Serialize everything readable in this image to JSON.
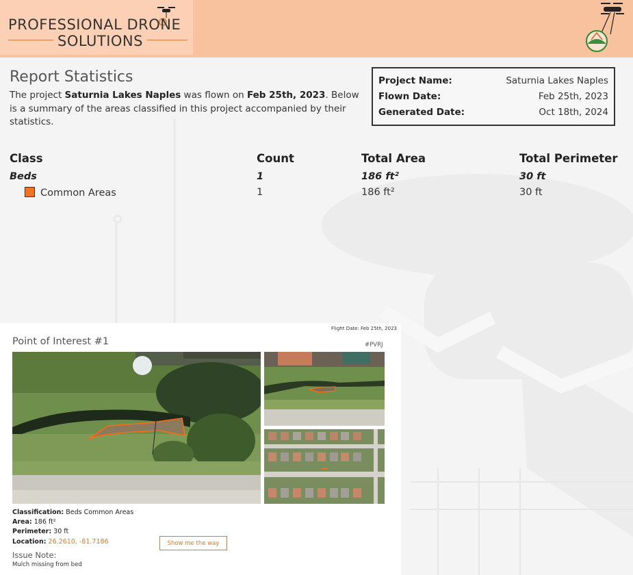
{
  "header": {
    "logo_line1": "PROFESSIONAL DRONE",
    "logo_line2": "SOLUTIONS"
  },
  "report": {
    "title": "Report Statistics",
    "intro_pre": "The project ",
    "project_name": "Saturnia Lakes Naples",
    "intro_mid": " was flown on ",
    "flown_date": "Feb 25th, 2023",
    "intro_post": ". Below is a summary of the areas classified in this project accompanied by their statistics."
  },
  "info": {
    "project_label": "Project Name:",
    "project_value": "Saturnia Lakes Naples",
    "flown_label": "Flown Date:",
    "flown_value": "Feb 25th, 2023",
    "generated_label": "Generated Date:",
    "generated_value": "Oct 18th, 2024"
  },
  "stats": {
    "headers": [
      "Class",
      "Count",
      "Total Area",
      "Total Perimeter"
    ],
    "group": {
      "name": "Beds",
      "count": "1",
      "area": "186 ft²",
      "perimeter": "30 ft"
    },
    "items": [
      {
        "name": "Common Areas",
        "count": "1",
        "area": "186 ft²",
        "perimeter": "30 ft",
        "color": "#f07422"
      }
    ]
  },
  "poi": {
    "flight_date": "Flight Date: Feb 25th, 2023",
    "title": "Point of Interest #1",
    "code": "#PVRJ",
    "classification_label": "Classification:",
    "classification_value": "Beds Common Areas",
    "area_label": "Area:",
    "area_value": "186 ft²",
    "perimeter_label": "Perimeter:",
    "perimeter_value": "30 ft",
    "location_label": "Location:",
    "location_value": "26.2610, -81.7186",
    "button_label": "Show me the way",
    "issue_label": "Issue Note:",
    "issue_text": "Mulch missing from bed"
  },
  "colors": {
    "header_bg": "#f9c29f",
    "accent": "#e8761f",
    "class_swatch": "#f07422"
  }
}
